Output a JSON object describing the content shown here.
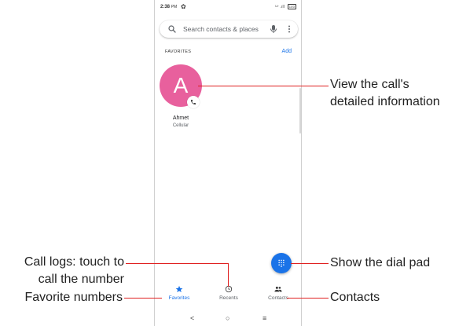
{
  "status_bar": {
    "time": "2:38",
    "ampm": "PM",
    "right": "ᵁ⁷ .ıll",
    "battery": "100"
  },
  "search": {
    "placeholder": "Search contacts & places"
  },
  "favorites": {
    "section_title": "FAVORITES",
    "add_label": "Add",
    "contact": {
      "initial": "A",
      "name": "Ahmet",
      "type": "Cellular",
      "avatar_color": "#e8609d"
    }
  },
  "bottom_nav": {
    "items": [
      {
        "label": "Favorites",
        "icon": "star-icon"
      },
      {
        "label": "Recents",
        "icon": "clock-icon"
      },
      {
        "label": "Contacts",
        "icon": "people-icon"
      }
    ]
  },
  "system_nav": {
    "back": "<",
    "home": "○",
    "recents": "≡"
  },
  "annotations": {
    "view_call_line1": "View the call's",
    "view_call_line2": "detailed information",
    "call_logs_line1": "Call logs: touch to",
    "call_logs_line2": "call the number",
    "favorite_numbers": "Favorite numbers",
    "dial_pad": "Show the dial pad",
    "contacts": "Contacts"
  },
  "colors": {
    "accent": "#1a73e8",
    "annotation_line": "#e02020"
  }
}
